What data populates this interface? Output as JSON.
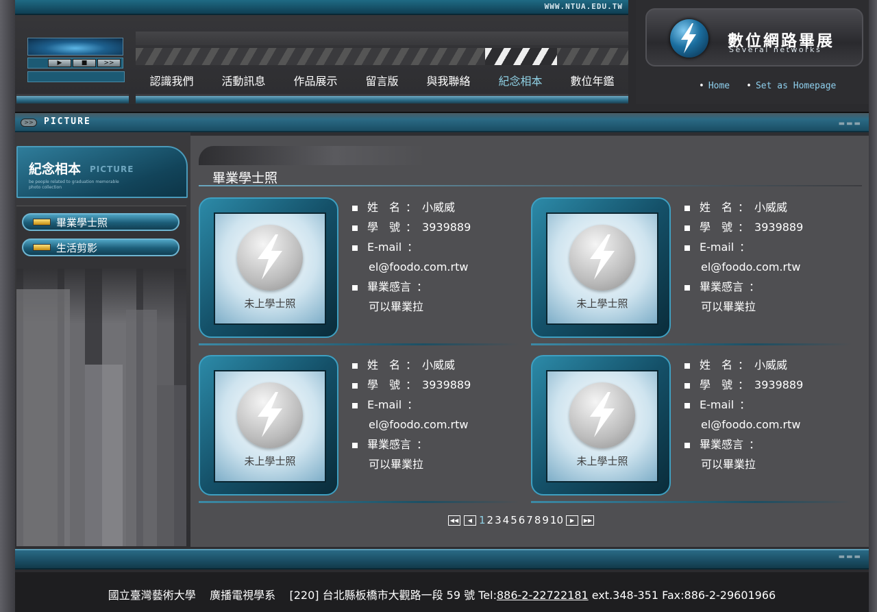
{
  "site": {
    "url": "WWW.NTUA.EDU.TW",
    "logo_title": "數位網路畢展",
    "logo_subtitle": "Several networks",
    "home_label": "Home",
    "homepage_label": "Set as Homepage"
  },
  "player": {
    "play": "▶",
    "stop": "■",
    "next": ">>"
  },
  "nav": {
    "items": [
      {
        "label": "認識我們"
      },
      {
        "label": "活動訊息"
      },
      {
        "label": "作品展示"
      },
      {
        "label": "留言版"
      },
      {
        "label": "與我聯絡"
      },
      {
        "label": "紀念相本"
      },
      {
        "label": "數位年鑑"
      }
    ],
    "active_index": 5
  },
  "title_bar": {
    "chip": ">>",
    "label": "PICTURE",
    "dashes": "▬▬▬"
  },
  "sidebar": {
    "title": "紀念相本",
    "title_en": "PICTURE",
    "fine_print": "be people related to graduation memorable photo collection",
    "items": [
      {
        "label": "畢業學士照"
      },
      {
        "label": "生活剪影"
      }
    ]
  },
  "section": {
    "title": "畢業學士照"
  },
  "cards": [
    {
      "caption": "未上學士照",
      "name_label": "姓　名",
      "name": "小威威",
      "id_label": "學　號",
      "id": "3939889",
      "email_label": "E-mail",
      "email": "el@foodo.com.rtw",
      "message_label": "畢業感言",
      "message": "可以畢業拉"
    },
    {
      "caption": "未上學士照",
      "name_label": "姓　名",
      "name": "小威威",
      "id_label": "學　號",
      "id": "3939889",
      "email_label": "E-mail",
      "email": "el@foodo.com.rtw",
      "message_label": "畢業感言",
      "message": "可以畢業拉"
    },
    {
      "caption": "未上學士照",
      "name_label": "姓　名",
      "name": "小威威",
      "id_label": "學　號",
      "id": "3939889",
      "email_label": "E-mail",
      "email": "el@foodo.com.rtw",
      "message_label": "畢業感言",
      "message": "可以畢業拉"
    },
    {
      "caption": "未上學士照",
      "name_label": "姓　名",
      "name": "小威威",
      "id_label": "學　號",
      "id": "3939889",
      "email_label": "E-mail",
      "email": "el@foodo.com.rtw",
      "message_label": "畢業感言",
      "message": "可以畢業拉"
    }
  ],
  "pager": {
    "first": "◀◀",
    "prev": "◀",
    "next": "▶",
    "last": "▶▶",
    "pages": [
      "1",
      "2",
      "3",
      "4",
      "5",
      "6",
      "7",
      "8",
      "9",
      "10"
    ],
    "current": "1"
  },
  "footer": {
    "school": "國立臺灣藝術大學",
    "department": "廣播電視學系",
    "address": "[220] 台北縣板橋市大觀路一段 59 號",
    "tel_label": "Tel:",
    "tel": "886-2-22722181",
    "ext": "ext.348-351",
    "fax": "Fax:886-2-29601966"
  },
  "colors": {
    "accent": "#8fd0e4",
    "brand_teal": "#1c5d78"
  }
}
